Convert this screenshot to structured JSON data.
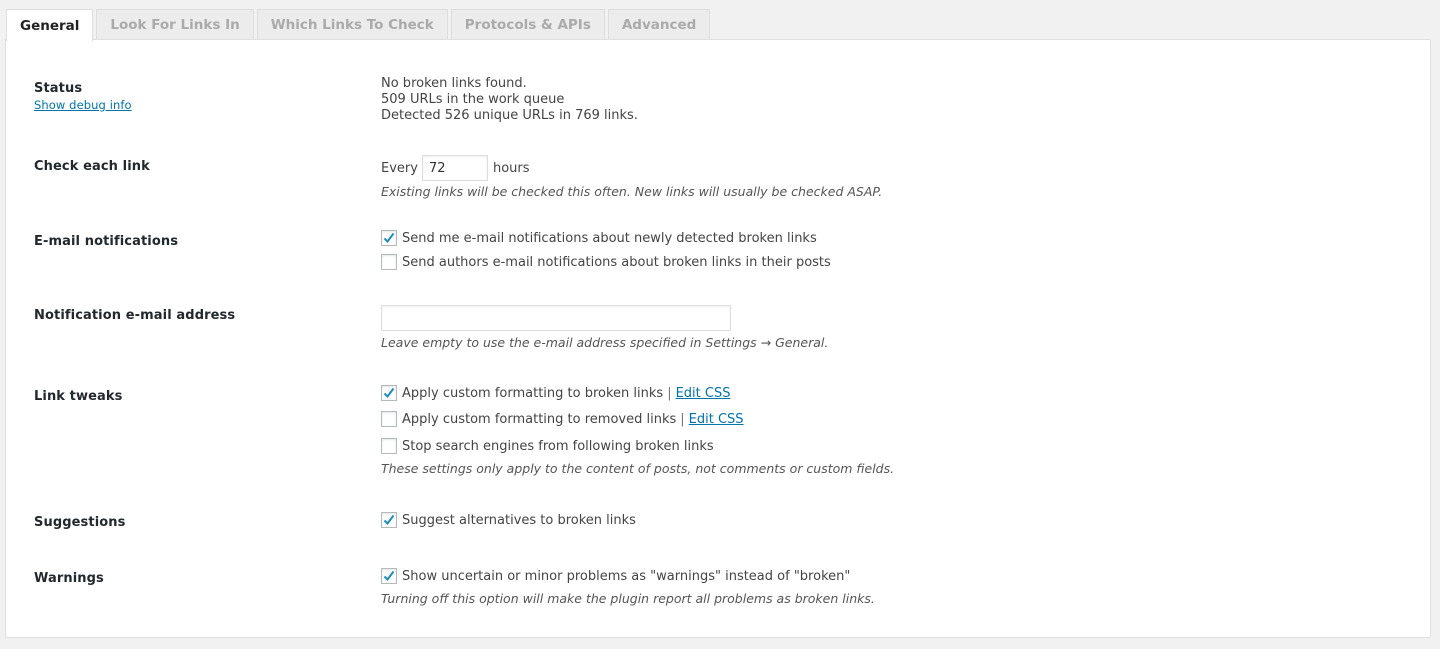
{
  "tabs": [
    {
      "label": "General",
      "active": true
    },
    {
      "label": "Look For Links In",
      "active": false
    },
    {
      "label": "Which Links To Check",
      "active": false
    },
    {
      "label": "Protocols & APIs",
      "active": false
    },
    {
      "label": "Advanced",
      "active": false
    }
  ],
  "status": {
    "label": "Status",
    "debug_link": "Show debug info",
    "lines": [
      "No broken links found.",
      "509 URLs in the work queue",
      "Detected 526 unique URLs in 769 links."
    ]
  },
  "check_each": {
    "label": "Check each link",
    "prefix": "Every",
    "value": "72",
    "suffix": "hours",
    "desc": "Existing links will be checked this often. New links will usually be checked ASAP."
  },
  "email_notifications": {
    "label": "E-mail notifications",
    "options": [
      {
        "label": "Send me e-mail notifications about newly detected broken links",
        "checked": true
      },
      {
        "label": "Send authors e-mail notifications about broken links in their posts",
        "checked": false
      }
    ]
  },
  "notification_email": {
    "label": "Notification e-mail address",
    "value": "",
    "desc": "Leave empty to use the e-mail address specified in Settings → General."
  },
  "link_tweaks": {
    "label": "Link tweaks",
    "options": [
      {
        "label": "Apply custom formatting to broken links",
        "checked": true,
        "link": "Edit CSS",
        "separator": "|"
      },
      {
        "label": "Apply custom formatting to removed links",
        "checked": false,
        "link": "Edit CSS",
        "separator": "|"
      },
      {
        "label": "Stop search engines from following broken links",
        "checked": false
      }
    ],
    "desc": "These settings only apply to the content of posts, not comments or custom fields."
  },
  "suggestions": {
    "label": "Suggestions",
    "option": {
      "label": "Suggest alternatives to broken links",
      "checked": true
    }
  },
  "warnings": {
    "label": "Warnings",
    "option": {
      "label": "Show uncertain or minor problems as \"warnings\" instead of \"broken\"",
      "checked": true
    },
    "desc": "Turning off this option will make the plugin report all problems as broken links."
  },
  "colors": {
    "link": "#0073aa",
    "check": "#1e8cbe"
  }
}
